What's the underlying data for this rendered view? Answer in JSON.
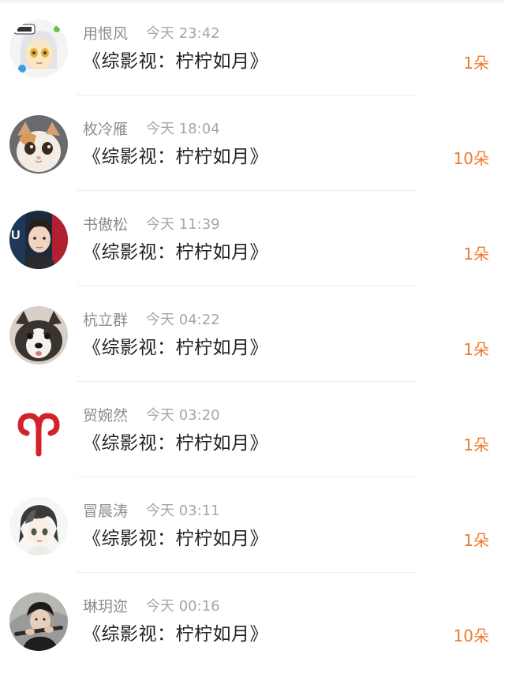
{
  "messages": [
    {
      "name": "用恨风",
      "time": "今天 23:42",
      "title": "《综影视：柠柠如月》",
      "count": "1朵",
      "avatar": "anime-girl-avatar"
    },
    {
      "name": "枚冷雁",
      "time": "今天 18:04",
      "title": "《综影视：柠柠如月》",
      "count": "10朵",
      "avatar": "kitten-avatar"
    },
    {
      "name": "书傲松",
      "time": "今天 11:39",
      "title": "《综影视：柠柠如月》",
      "count": "1朵",
      "avatar": "man-portrait-avatar"
    },
    {
      "name": "杭立群",
      "time": "今天 04:22",
      "title": "《综影视：柠柠如月》",
      "count": "1朵",
      "avatar": "puppy-avatar"
    },
    {
      "name": "贸婉然",
      "time": "今天 03:20",
      "title": "《综影视：柠柠如月》",
      "count": "1朵",
      "avatar": "aries-symbol-avatar"
    },
    {
      "name": "冒晨涛",
      "time": "今天 03:11",
      "title": "《综影视：柠柠如月》",
      "count": "1朵",
      "avatar": "anime-boy-avatar"
    },
    {
      "name": "琳玥迩",
      "time": "今天 00:16",
      "title": "《综影视：柠柠如月》",
      "count": "10朵",
      "avatar": "flute-player-avatar"
    }
  ],
  "colors": {
    "count_accent": "#f0782d",
    "name_gray": "#8e8e8e",
    "title_dark": "#222222"
  }
}
